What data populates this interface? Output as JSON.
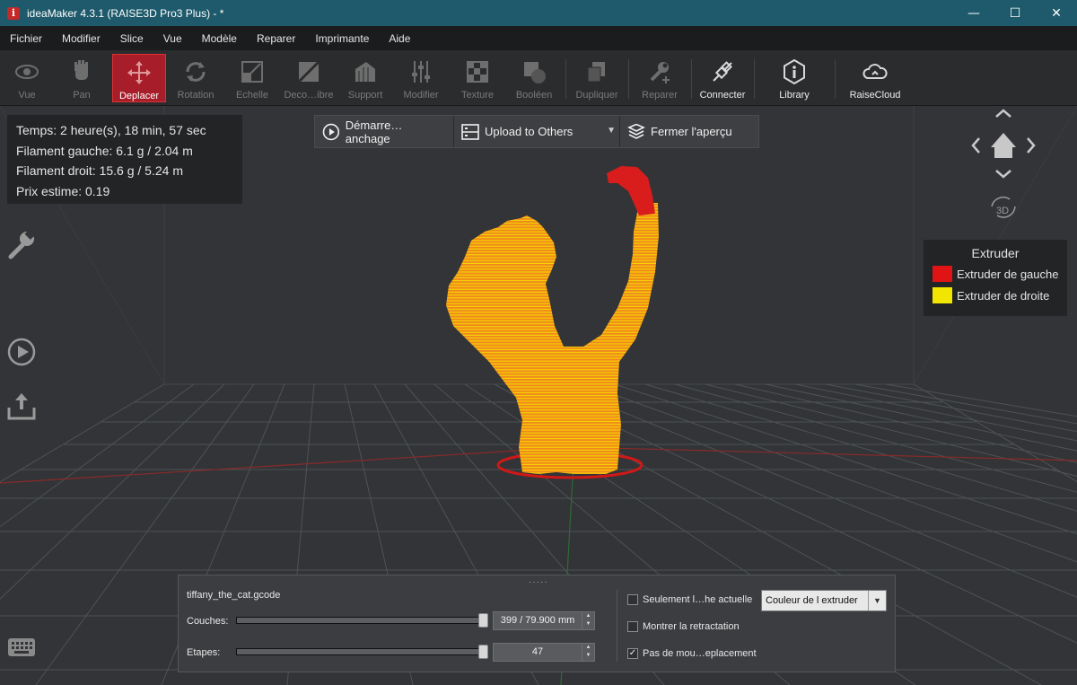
{
  "window": {
    "title": "ideaMaker 4.3.1 (RAISE3D Pro3 Plus) - *",
    "app_icon": "i",
    "minimize": "—",
    "maximize": "☐",
    "close": "✕"
  },
  "menu": [
    "Fichier",
    "Modifier",
    "Slice",
    "Vue",
    "Modèle",
    "Reparer",
    "Imprimante",
    "Aide"
  ],
  "toolbar": {
    "vue": "Vue",
    "pan": "Pan",
    "deplacer": "Deplacer",
    "rotation": "Rotation",
    "echelle": "Echelle",
    "decoupe": "Deco…ibre",
    "support": "Support",
    "modifier": "Modifier",
    "texture": "Texture",
    "booleen": "Booléen",
    "dupliquer": "Dupliquer",
    "reparer": "Reparer",
    "connecter": "Connecter",
    "library": "Library",
    "raisecloud": "RaiseCloud"
  },
  "info": {
    "time": "Temps: 2 heure(s), 18 min, 57 sec",
    "left_filament": "Filament gauche: 6.1 g / 2.04 m",
    "right_filament": "Filament droit: 15.6 g / 5.24 m",
    "price": "Prix estime: 0.19"
  },
  "preview": {
    "start": "Démarre…anchage",
    "upload": "Upload to Others",
    "close": "Fermer l'aperçu"
  },
  "nav": {
    "three_d": "3D"
  },
  "legend": {
    "title": "Extruder",
    "left": "Extruder de gauche",
    "right": "Extruder de droite",
    "left_color": "#e01414",
    "right_color": "#f2e600"
  },
  "bottom": {
    "file": "tiffany_the_cat.gcode",
    "layers_label": "Couches:",
    "layers_value": "399 / 79.900 mm",
    "steps_label": "Etapes:",
    "steps_value": "47",
    "layers_fraction": 1.0,
    "steps_fraction": 1.0,
    "only_current": "Seulement l…he actuelle",
    "show_retraction": "Montrer la retractation",
    "no_travel": "Pas de mou…eplacement",
    "only_current_checked": false,
    "show_retraction_checked": false,
    "no_travel_checked": true,
    "color_mode": "Couleur de l extruder",
    "grip": "·····"
  },
  "colors": {
    "accent": "#a71d2a",
    "titlebar": "#1e5a6b",
    "model_orange": "#f08a1e",
    "model_yellow": "#f2e600",
    "model_red": "#d91c1c"
  }
}
